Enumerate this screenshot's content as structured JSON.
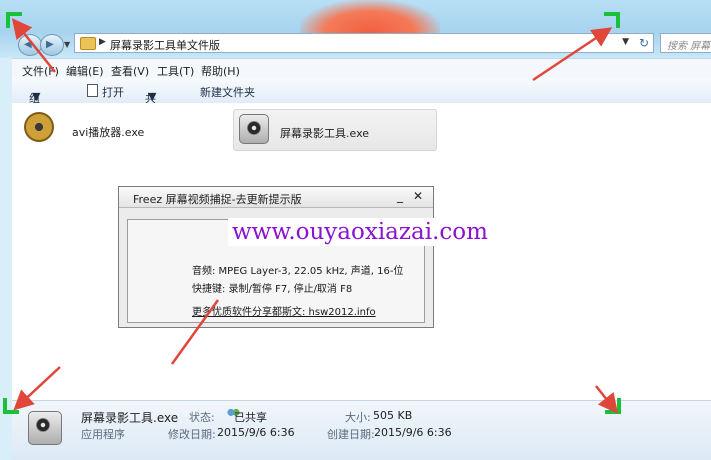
{
  "address": {
    "path": "屏幕录影工具单文件版"
  },
  "search": {
    "placeholder": "搜索 屏幕"
  },
  "menu": [
    "文件(F)",
    "编辑(E)",
    "查看(V)",
    "工具(T)",
    "帮助(H)"
  ],
  "toolbar": {
    "organize": "组织",
    "open": "打开",
    "share": "共享",
    "new_folder": "新建文件夹"
  },
  "files": [
    {
      "name": "avi播放器.exe",
      "icon": "film-reel-icon",
      "selected": false
    },
    {
      "name": "屏幕录影工具.exe",
      "icon": "camera-icon",
      "selected": true
    }
  ],
  "dialog": {
    "title": "Freez 屏幕视频捕捉-去更新提示版",
    "minimize": "_",
    "close": "✕",
    "audio": "音频: MPEG Layer-3, 22.05 kHz, 声道, 16-位",
    "hotkeys": "快捷键: 录制/暂停 F7, 停止/取消 F8",
    "more_link": "更多优质软件分享都斯文: hsw2012.info"
  },
  "watermark": "www.ouyaoxiazai.com",
  "details": {
    "name": "屏幕录影工具.exe",
    "type": "应用程序",
    "status_label": "状态:",
    "status_value": "已共享",
    "modified_label": "修改日期:",
    "modified_value": "2015/9/6 6:36",
    "size_label": "大小:",
    "size_value": "505 KB",
    "created_label": "创建日期:",
    "created_value": "2015/9/6 6:36"
  },
  "colors": {
    "annotation": "#19c13a",
    "arrow": "#e0473a",
    "watermark": "#8a12d0"
  }
}
